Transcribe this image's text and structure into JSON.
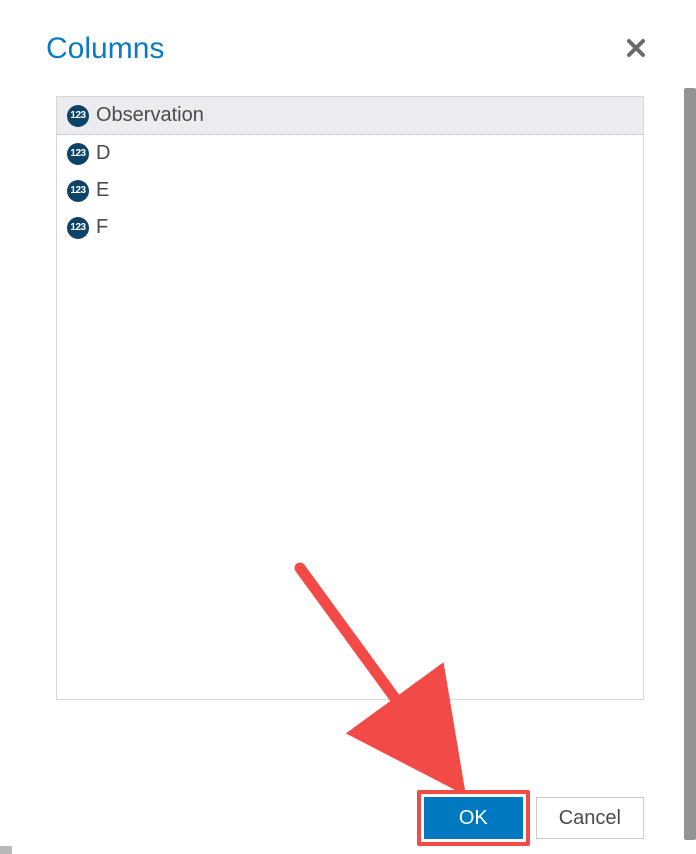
{
  "dialog": {
    "title": "Columns",
    "items": [
      {
        "label": "Observation",
        "icon_text": "123",
        "selected": true
      },
      {
        "label": "D",
        "icon_text": "123",
        "selected": false
      },
      {
        "label": "E",
        "icon_text": "123",
        "selected": false
      },
      {
        "label": "F",
        "icon_text": "123",
        "selected": false
      }
    ],
    "buttons": {
      "ok": "OK",
      "cancel": "Cancel"
    }
  }
}
